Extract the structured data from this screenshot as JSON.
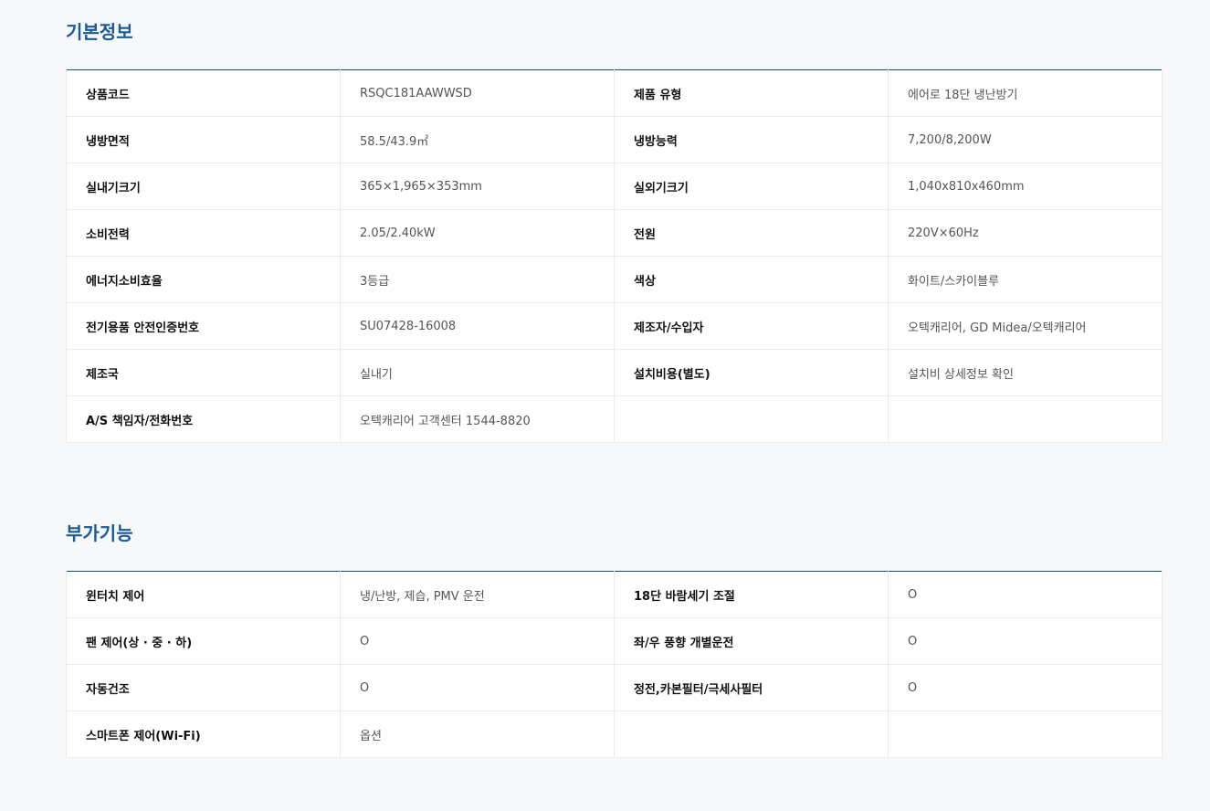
{
  "basic": {
    "title": "기본정보",
    "rows": [
      [
        {
          "label": "상품코드",
          "value": "RSQC181AAWWSD"
        },
        {
          "label": "제품 유형",
          "value": "에어로 18단 냉난방기"
        }
      ],
      [
        {
          "label": "냉방면적",
          "value": "58.5/43.9㎡"
        },
        {
          "label": "냉방능력",
          "value": "7,200/8,200W"
        }
      ],
      [
        {
          "label": "실내기크기",
          "value": "365×1,965×353mm"
        },
        {
          "label": "실외기크기",
          "value": "1,040x810x460mm"
        }
      ],
      [
        {
          "label": "소비전력",
          "value": "2.05/2.40kW"
        },
        {
          "label": "전원",
          "value": "220V×60Hz"
        }
      ],
      [
        {
          "label": "에너지소비효율",
          "value": "3등급"
        },
        {
          "label": "색상",
          "value": "화이트/스카이블루"
        }
      ],
      [
        {
          "label": "전기용품 안전인증번호",
          "value": "SU07428-16008"
        },
        {
          "label": "제조자/수입자",
          "value": "오텍캐리어, GD Midea/오텍캐리어"
        }
      ],
      [
        {
          "label": "제조국",
          "value": "실내기"
        },
        {
          "label": "설치비용(별도)",
          "value": "설치비 상세정보 확인"
        }
      ],
      [
        {
          "label": "A/S 책임자/전화번호",
          "value": "오텍캐리어 고객센터 1544-8820"
        },
        {
          "label": "",
          "value": ""
        }
      ]
    ]
  },
  "extra": {
    "title": "부가기능",
    "rows": [
      [
        {
          "label": "윈터치 제어",
          "value": "냉/난방, 제습, PMV 운전"
        },
        {
          "label": "18단 바람세기 조절",
          "value": "O"
        }
      ],
      [
        {
          "label": "팬 제어(상 · 중 · 하)",
          "value": "O"
        },
        {
          "label": "좌/우 풍향 개별운전",
          "value": "O"
        }
      ],
      [
        {
          "label": "자동건조",
          "value": "O"
        },
        {
          "label": "정전,카본필터/극세사필터",
          "value": "O"
        }
      ],
      [
        {
          "label": "스마트폰 제어(Wi-Fi)",
          "value": "옵션"
        },
        {
          "label": "",
          "value": ""
        }
      ]
    ]
  }
}
